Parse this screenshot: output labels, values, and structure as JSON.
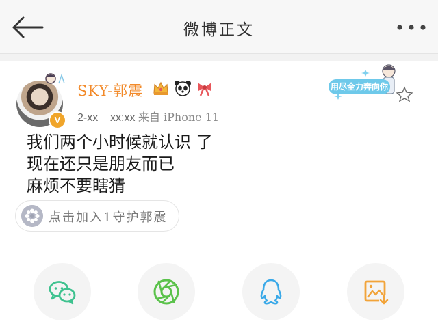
{
  "header": {
    "title": "微博正文",
    "back_icon": "back-arrow-icon",
    "more_icon": "more-dots-icon"
  },
  "post": {
    "author": {
      "name": "SKY-郭震",
      "verified_mark": "V",
      "badges": [
        "crown-badge-icon",
        "panda-badge-icon",
        "bow-badge-icon"
      ]
    },
    "meta": {
      "date": "2-xx",
      "time": "xx:xx",
      "source": "来自 iPhone 11"
    },
    "decoration_label": "用尽全力奔向你",
    "lines": [
      "我们两个小时候就认识 了",
      "现在还只是朋友而已",
      "麻烦不要瞎猜"
    ],
    "guard_button": {
      "label": "点击加入1守护郭震",
      "icon": "flower-icon"
    }
  },
  "share": [
    {
      "name": "wechat",
      "icon": "wechat-icon",
      "color": "#3ec28f"
    },
    {
      "name": "moments",
      "icon": "moments-shutter-icon",
      "color": "#5ac24a"
    },
    {
      "name": "qq",
      "icon": "qq-icon",
      "color": "#3aa9e8"
    },
    {
      "name": "save-image",
      "icon": "save-image-icon",
      "color": "#f2a43a"
    }
  ],
  "colors": {
    "username": "#f28a2a",
    "verified": "#f0a52a",
    "header_bg": "#f7f7f7"
  }
}
